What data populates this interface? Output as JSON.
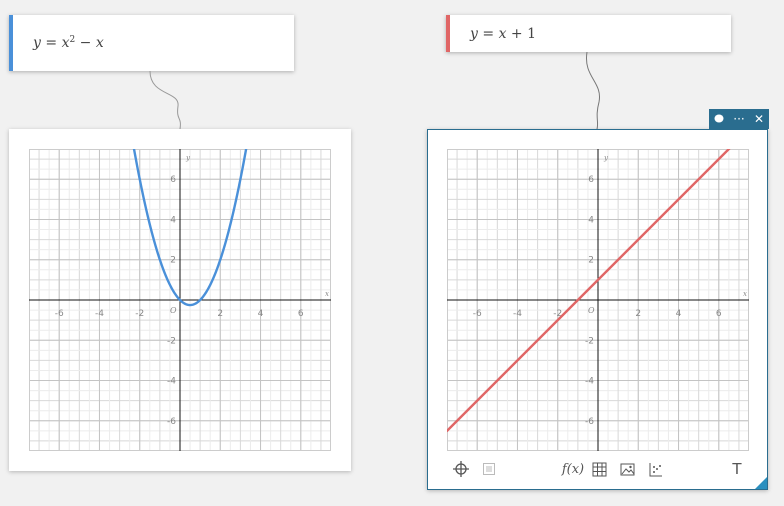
{
  "expressions": [
    {
      "var": "y",
      "eq": "=",
      "term1": "x",
      "exp": "2",
      "op": "−",
      "term2": "x",
      "color": "#4a90d9"
    },
    {
      "var": "y",
      "eq": "=",
      "term1": "x",
      "op": "+",
      "term2": "1",
      "color": "#e06666"
    }
  ],
  "graphs": [
    {
      "xlabel": "x",
      "ylabel": "y",
      "origin": "O",
      "x_ticks": [
        "-6",
        "-4",
        "-2",
        "2",
        "4",
        "6"
      ],
      "y_ticks": [
        "6",
        "4",
        "2",
        "-2",
        "-4",
        "-6"
      ]
    },
    {
      "xlabel": "x",
      "ylabel": "y",
      "origin": "O",
      "x_ticks": [
        "-6",
        "-4",
        "-2",
        "2",
        "4",
        "6"
      ],
      "y_ticks": [
        "6",
        "4",
        "2",
        "-2",
        "-4",
        "-6"
      ]
    }
  ],
  "chart_data": [
    {
      "type": "line",
      "series": [
        {
          "values_fn": "x^2 - x",
          "color": "#4a90d9"
        }
      ],
      "xlim": [
        -7.5,
        7.5
      ],
      "ylim": [
        -7.5,
        7.5
      ],
      "grid": true
    },
    {
      "type": "line",
      "series": [
        {
          "values_fn": "x + 1",
          "color": "#e06666"
        }
      ],
      "xlim": [
        -7.5,
        7.5
      ],
      "ylim": [
        -7.5,
        7.5
      ],
      "grid": true
    }
  ],
  "toolbar": {
    "crosshair_icon": "crosshair-icon",
    "list_icon": "list-icon",
    "function_label": "f(x)",
    "table_icon": "table-icon",
    "image_icon": "image-icon",
    "points_icon": "points-icon",
    "text_label": "T"
  },
  "float_bar": {
    "chat_icon": "chat-icon",
    "more_label": "···",
    "close_label": "✕"
  }
}
